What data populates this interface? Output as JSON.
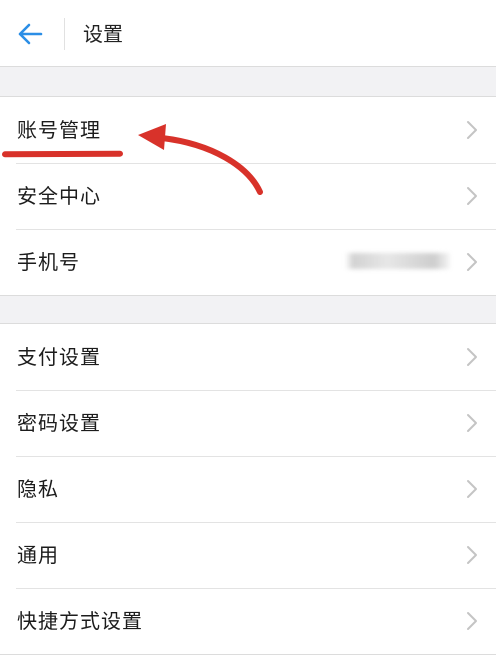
{
  "header": {
    "title": "设置"
  },
  "groups": [
    {
      "items": [
        {
          "label": "账号管理"
        },
        {
          "label": "安全中心"
        },
        {
          "label": "手机号"
        }
      ]
    },
    {
      "items": [
        {
          "label": "支付设置"
        },
        {
          "label": "密码设置"
        },
        {
          "label": "隐私"
        },
        {
          "label": "通用"
        },
        {
          "label": "快捷方式设置"
        }
      ]
    }
  ],
  "colors": {
    "accent": "#2b8ee6",
    "annotation": "#d8322a",
    "chevron": "#c4c4c4",
    "background": "#f2f2f4"
  }
}
